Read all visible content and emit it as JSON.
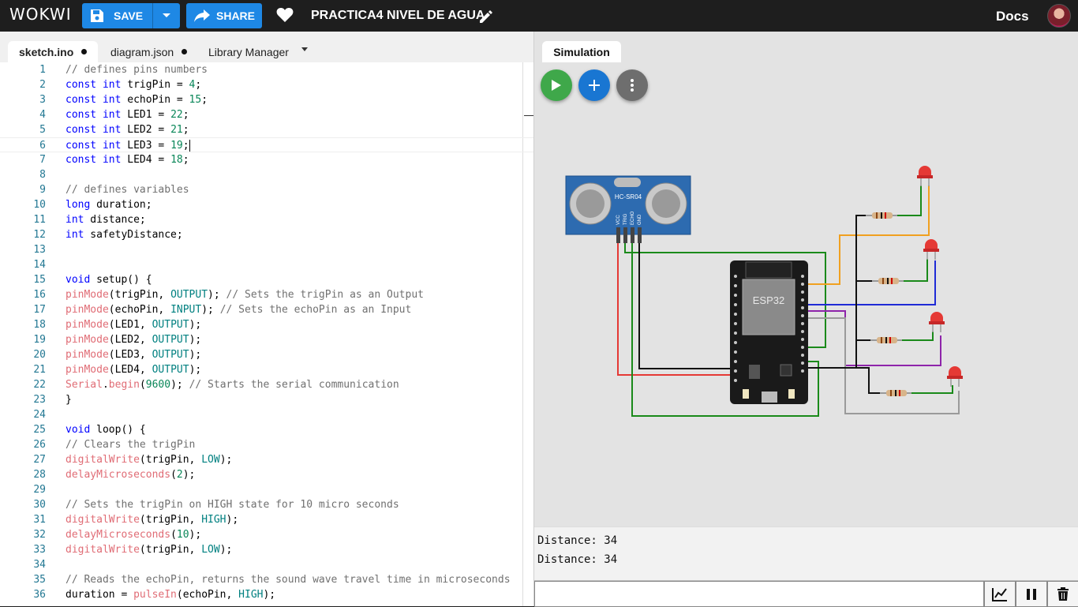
{
  "topbar": {
    "logo": "WOKWI",
    "save_label": "SAVE",
    "share_label": "SHARE",
    "project_title": "PRACTICA4 NIVEL DE AGUA",
    "docs_label": "Docs",
    "icons": [
      "save-icon",
      "chevron-down-icon",
      "share-arrow-icon",
      "heart-icon",
      "pencil-icon",
      "avatar"
    ]
  },
  "editor": {
    "tabs": [
      {
        "label": "sketch.ino",
        "modified": true,
        "active": true
      },
      {
        "label": "diagram.json",
        "modified": true,
        "active": false
      },
      {
        "label": "Library Manager",
        "modified": false,
        "active": false
      }
    ],
    "current_line": 6,
    "lines": [
      "// defines pins numbers",
      "const int trigPin = 4;",
      "const int echoPin = 15;",
      "const int LED1 = 22;",
      "const int LED2 = 21;",
      "const int LED3 = 19;",
      "const int LED4 = 18;",
      "",
      "// defines variables",
      "long duration;",
      "int distance;",
      "int safetyDistance;",
      "",
      "",
      "void setup() {",
      "pinMode(trigPin, OUTPUT); // Sets the trigPin as an Output",
      "pinMode(echoPin, INPUT); // Sets the echoPin as an Input",
      "pinMode(LED1, OUTPUT);",
      "pinMode(LED2, OUTPUT);",
      "pinMode(LED3, OUTPUT);",
      "pinMode(LED4, OUTPUT);",
      "Serial.begin(9600); // Starts the serial communication",
      "}",
      "",
      "void loop() {",
      "// Clears the trigPin",
      "digitalWrite(trigPin, LOW);",
      "delayMicroseconds(2);",
      "",
      "// Sets the trigPin on HIGH state for 10 micro seconds",
      "digitalWrite(trigPin, HIGH);",
      "delayMicroseconds(10);",
      "digitalWrite(trigPin, LOW);",
      "",
      "// Reads the echoPin, returns the sound wave travel time in microseconds",
      "duration = pulseIn(echoPin, HIGH);"
    ]
  },
  "simulation": {
    "tab_label": "Simulation",
    "sensor_label": "HC-SR04",
    "sensor_pins": [
      "VCC",
      "TRIG",
      "ECHO",
      "GND"
    ],
    "board_label": "ESP32",
    "serial_output": [
      "Distance: 34",
      "Distance: 34"
    ],
    "serial_input_value": "",
    "colors": {
      "play": "#3fa84a",
      "add": "#1976d2",
      "more": "#6e6e6e",
      "wire_red": "#e53935",
      "wire_green": "#1a8a1a",
      "wire_black": "#111111",
      "wire_orange": "#f0a020",
      "wire_blue": "#1f2bd6",
      "wire_purple": "#8e24aa",
      "wire_gray": "#9a9a9a"
    }
  }
}
